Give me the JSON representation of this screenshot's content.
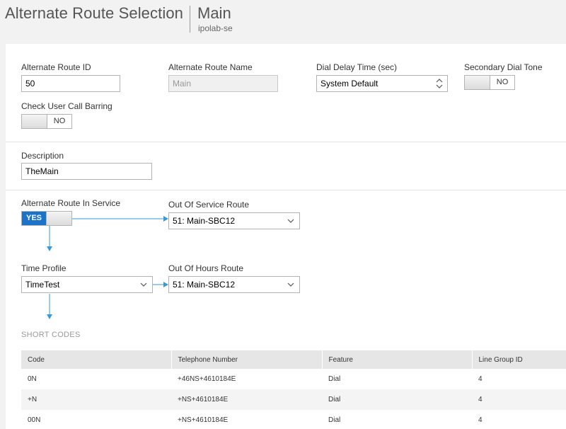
{
  "header": {
    "title": "Alternate Route Selection",
    "record_name": "Main",
    "record_sub": "ipolab-se"
  },
  "form": {
    "alt_route_id": {
      "label": "Alternate Route ID",
      "value": "50"
    },
    "alt_route_name": {
      "label": "Alternate Route Name",
      "value": "Main"
    },
    "dial_delay": {
      "label": "Dial Delay Time (sec)",
      "value": "System Default"
    },
    "secondary_dial_tone": {
      "label": "Secondary Dial Tone",
      "state": "NO"
    },
    "check_user_call_barring": {
      "label": "Check User Call Barring",
      "state": "NO"
    },
    "description": {
      "label": "Description",
      "value": "TheMain"
    },
    "in_service": {
      "label": "Alternate Route In Service",
      "state": "YES"
    },
    "out_of_service_route": {
      "label": "Out Of Service Route",
      "value": "51: Main-SBC12"
    },
    "time_profile": {
      "label": "Time Profile",
      "value": "TimeTest"
    },
    "out_of_hours_route": {
      "label": "Out Of Hours Route",
      "value": "51: Main-SBC12"
    }
  },
  "short_codes": {
    "title": "SHORT CODES",
    "columns": [
      "Code",
      "Telephone Number",
      "Feature",
      "Line Group ID"
    ],
    "rows": [
      [
        "0N",
        "+46NS+4610184E",
        "Dial",
        "4"
      ],
      [
        "+N",
        "+NS+4610184E",
        "Dial",
        "4"
      ],
      [
        "00N",
        "+NS+4610184E",
        "Dial",
        "4"
      ]
    ]
  },
  "colors": {
    "accent": "#1a73c8",
    "arrow": "#3a9ad9"
  }
}
